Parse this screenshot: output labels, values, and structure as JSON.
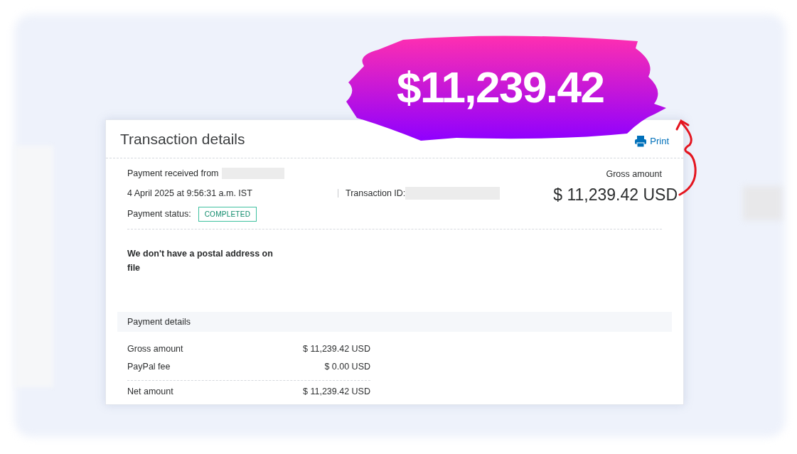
{
  "banner": {
    "amount": "$11,239.42"
  },
  "card": {
    "title": "Transaction details",
    "print": "Print"
  },
  "summary": {
    "received_label": "Payment received from",
    "date": "4 April 2025 at 9:56:31 a.m. IST",
    "transaction_id_label": "Transaction ID:",
    "status_label": "Payment status:",
    "status": "COMPLETED",
    "gross_label": "Gross amount",
    "gross_value": "$ 11,239.42 USD"
  },
  "address_note": "We don't have a postal address on file",
  "payment_details": {
    "title": "Payment details",
    "rows": [
      {
        "label": "Gross amount",
        "value": "$ 11,239.42 USD",
        "kind": "line"
      },
      {
        "label": "PayPal fee",
        "value": "$ 0.00 USD",
        "kind": "line"
      },
      {
        "label": "Net amount",
        "value": "$ 11,239.42 USD",
        "kind": "total"
      }
    ]
  }
}
